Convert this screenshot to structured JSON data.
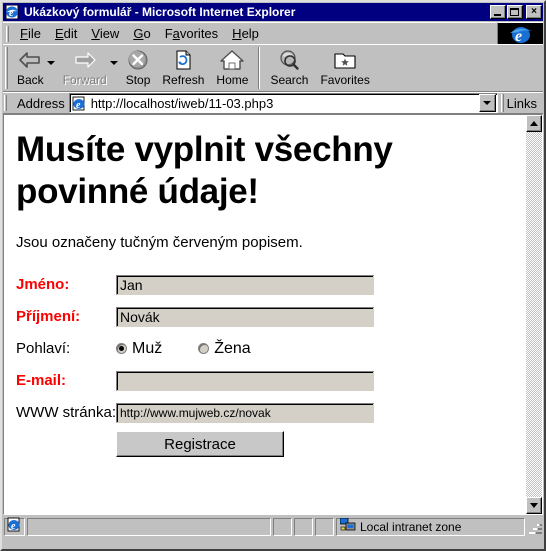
{
  "window": {
    "title": "Ukázkový formulář - Microsoft Internet Explorer",
    "title_icon": "ie-document-icon",
    "minimize_label": "",
    "maximize_label": "",
    "close_label": "×"
  },
  "menu": {
    "items": [
      {
        "label": "File",
        "accel": "F"
      },
      {
        "label": "Edit",
        "accel": "E"
      },
      {
        "label": "View",
        "accel": "V"
      },
      {
        "label": "Go",
        "accel": "G"
      },
      {
        "label": "Favorites",
        "accel": "a"
      },
      {
        "label": "Help",
        "accel": "H"
      }
    ],
    "logo_icon": "internet-explorer-logo"
  },
  "toolbar": {
    "buttons": [
      {
        "label": "Back",
        "icon": "arrow-left-icon",
        "disabled": false,
        "has_dropdown": true
      },
      {
        "label": "Forward",
        "icon": "arrow-right-icon",
        "disabled": true,
        "has_dropdown": true
      },
      {
        "label": "Stop",
        "icon": "stop-icon",
        "disabled": false,
        "has_dropdown": false
      },
      {
        "label": "Refresh",
        "icon": "refresh-icon",
        "disabled": false,
        "has_dropdown": false
      },
      {
        "label": "Home",
        "icon": "home-icon",
        "disabled": false,
        "has_dropdown": false
      },
      {
        "label": "Search",
        "icon": "search-icon",
        "disabled": false,
        "has_dropdown": false
      },
      {
        "label": "Favorites",
        "icon": "favorites-folder-icon",
        "disabled": false,
        "has_dropdown": false
      }
    ]
  },
  "address_bar": {
    "label": "Address",
    "icon": "ie-page-icon",
    "url": "http://localhost/iweb/11-03.php3",
    "dropdown_icon": "chevron-down-icon",
    "links_label": "Links"
  },
  "page": {
    "heading": "Musíte vyplnit všechny povinné údaje!",
    "subtitle": "Jsou označeny tučným červeným popisem.",
    "required_color": "#ff0000",
    "fields": [
      {
        "label": "Jméno:",
        "required": true,
        "value": "Jan",
        "type": "text"
      },
      {
        "label": "Příjmení:",
        "required": true,
        "value": "Novák",
        "type": "text"
      },
      {
        "label": "Pohlaví:",
        "required": false,
        "type": "radio"
      },
      {
        "label": "E-mail:",
        "required": true,
        "value": "",
        "type": "text"
      },
      {
        "label": "WWW stránka:",
        "required": false,
        "value": "http://www.mujweb.cz/novak",
        "type": "text"
      }
    ],
    "radios": [
      {
        "label": "Muž",
        "checked": true
      },
      {
        "label": "Žena",
        "checked": false
      }
    ],
    "submit_label": "Registrace"
  },
  "status_bar": {
    "message": "",
    "zone_icon": "network-zone-icon",
    "zone_text": "Local intranet zone",
    "doc_icon": "ie-doc-icon"
  }
}
